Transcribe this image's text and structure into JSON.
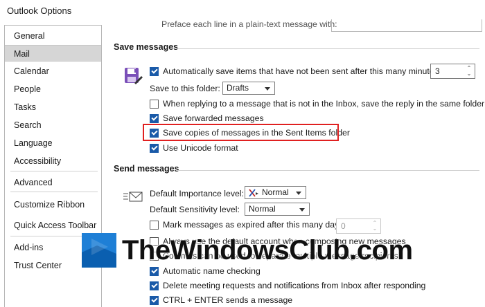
{
  "window": {
    "title": "Outlook Options"
  },
  "sidebar": {
    "items": [
      {
        "label": "General"
      },
      {
        "label": "Mail",
        "selected": true
      },
      {
        "label": "Calendar"
      },
      {
        "label": "People"
      },
      {
        "label": "Tasks"
      },
      {
        "label": "Search"
      },
      {
        "label": "Language"
      },
      {
        "label": "Accessibility"
      },
      {
        "label": "Advanced"
      },
      {
        "label": "Customize Ribbon"
      },
      {
        "label": "Quick Access Toolbar"
      },
      {
        "label": "Add-ins"
      },
      {
        "label": "Trust Center"
      }
    ]
  },
  "top_truncated": {
    "text": "Preface each line in a plain-text message with:"
  },
  "save_messages": {
    "header": "Save messages",
    "autosave": {
      "label": "Automatically save items that have not been sent after this many minutes:",
      "checked": true,
      "minutes": "3"
    },
    "save_to_folder": {
      "label": "Save to this folder:",
      "value": "Drafts"
    },
    "reply_same_folder": {
      "label": "When replying to a message that is not in the Inbox, save the reply in the same folder",
      "checked": false
    },
    "save_forwarded": {
      "label": "Save forwarded messages",
      "checked": true
    },
    "save_sent_copies": {
      "label": "Save copies of messages in the Sent Items folder",
      "checked": true
    },
    "use_unicode": {
      "label": "Use Unicode format",
      "checked": true
    }
  },
  "send_messages": {
    "header": "Send messages",
    "importance": {
      "label": "Default Importance level:",
      "value": "Normal"
    },
    "sensitivity": {
      "label": "Default Sensitivity level:",
      "value": "Normal"
    },
    "expire": {
      "label": "Mark messages as expired after this many days:",
      "checked": false,
      "days": "0"
    },
    "default_account": {
      "label": "Always use the default account when composing new messages",
      "checked": false
    },
    "commas": {
      "label": "Commas can be used to separate multiple message recipients",
      "checked": false
    },
    "auto_name_check": {
      "label": "Automatic name checking",
      "checked": true
    },
    "delete_meeting": {
      "label": "Delete meeting requests and notifications from Inbox after responding",
      "checked": true
    },
    "ctrl_enter": {
      "label": "CTRL + ENTER sends a message",
      "checked": true
    }
  },
  "watermark": {
    "text": "TheWindowsClub.com"
  },
  "colors": {
    "highlight": "#e02020",
    "checkbox_accent": "#1a5aa8",
    "selected_nav": "#d6d6d6"
  }
}
